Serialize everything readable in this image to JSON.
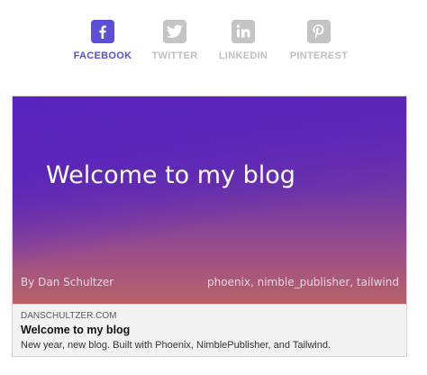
{
  "share_tabs": [
    {
      "label": "FACEBOOK",
      "icon": "facebook-icon",
      "active": true
    },
    {
      "label": "TWITTER",
      "icon": "twitter-icon",
      "active": false
    },
    {
      "label": "LINKEDIN",
      "icon": "linkedin-icon",
      "active": false
    },
    {
      "label": "PINTEREST",
      "icon": "pinterest-icon",
      "active": false
    }
  ],
  "preview": {
    "image_title": "Welcome to my blog",
    "author": "By Dan Schultzer",
    "tags": "phoenix, nimble_publisher, tailwind",
    "domain": "DANSCHULTZER.COM",
    "title": "Welcome to my blog",
    "description": "New year, new blog. Built with Phoenix, NimblePublisher, and Tailwind."
  },
  "colors": {
    "accent": "#5a4fd6",
    "inactive": "#c0c0c0",
    "gradient_top": "#5a26b8",
    "gradient_bottom": "#b86268"
  }
}
